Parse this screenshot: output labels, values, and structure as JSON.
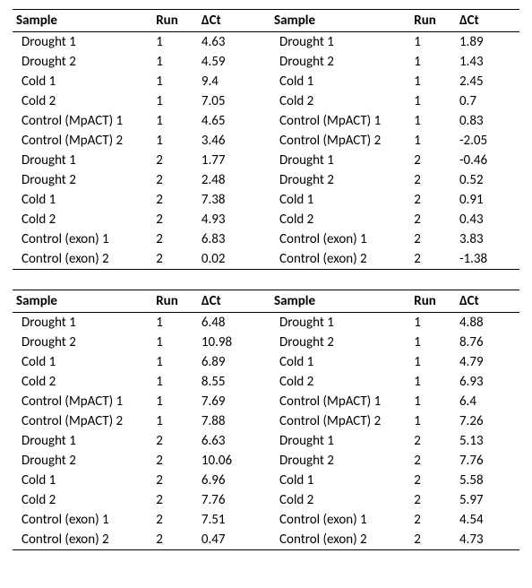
{
  "headers": {
    "sample": "Sample",
    "run": "Run",
    "dct": "ΔCt"
  },
  "sample_names": {
    "drought1": "Drought 1",
    "drought2": "Drought 2",
    "cold1": "Cold 1",
    "cold2": "Cold 2",
    "mpact1": "Control (MpACT) 1",
    "mpact2": "Control (MpACT) 2",
    "exon1": "Control (exon) 1",
    "exon2": "Control (exon) 2"
  },
  "tables": [
    {
      "left": [
        {
          "sample_key": "drought1",
          "run": "1",
          "dct": "4.63"
        },
        {
          "sample_key": "drought2",
          "run": "1",
          "dct": "4.59"
        },
        {
          "sample_key": "cold1",
          "run": "1",
          "dct": "9.4"
        },
        {
          "sample_key": "cold2",
          "run": "1",
          "dct": "7.05"
        },
        {
          "sample_key": "mpact1",
          "run": "1",
          "dct": "4.65"
        },
        {
          "sample_key": "mpact2",
          "run": "1",
          "dct": "3.46"
        },
        {
          "sample_key": "drought1",
          "run": "2",
          "dct": "1.77"
        },
        {
          "sample_key": "drought2",
          "run": "2",
          "dct": "2.48"
        },
        {
          "sample_key": "cold1",
          "run": "2",
          "dct": "7.38"
        },
        {
          "sample_key": "cold2",
          "run": "2",
          "dct": "4.93"
        },
        {
          "sample_key": "exon1",
          "run": "2",
          "dct": "6.83"
        },
        {
          "sample_key": "exon2",
          "run": "2",
          "dct": "0.02"
        }
      ],
      "right": [
        {
          "sample_key": "drought1",
          "run": "1",
          "dct": "1.89"
        },
        {
          "sample_key": "drought2",
          "run": "1",
          "dct": "1.43"
        },
        {
          "sample_key": "cold1",
          "run": "1",
          "dct": "2.45"
        },
        {
          "sample_key": "cold2",
          "run": "1",
          "dct": "0.7"
        },
        {
          "sample_key": "mpact1",
          "run": "1",
          "dct": "0.83"
        },
        {
          "sample_key": "mpact2",
          "run": "1",
          "dct": "-2.05"
        },
        {
          "sample_key": "drought1",
          "run": "2",
          "dct": "-0.46"
        },
        {
          "sample_key": "drought2",
          "run": "2",
          "dct": "0.52"
        },
        {
          "sample_key": "cold1",
          "run": "2",
          "dct": "0.91"
        },
        {
          "sample_key": "cold2",
          "run": "2",
          "dct": "0.43"
        },
        {
          "sample_key": "exon1",
          "run": "2",
          "dct": "3.83"
        },
        {
          "sample_key": "exon2",
          "run": "2",
          "dct": "-1.38"
        }
      ]
    },
    {
      "left": [
        {
          "sample_key": "drought1",
          "run": "1",
          "dct": "6.48"
        },
        {
          "sample_key": "drought2",
          "run": "1",
          "dct": "10.98"
        },
        {
          "sample_key": "cold1",
          "run": "1",
          "dct": "6.89"
        },
        {
          "sample_key": "cold2",
          "run": "1",
          "dct": "8.55"
        },
        {
          "sample_key": "mpact1",
          "run": "1",
          "dct": "7.69"
        },
        {
          "sample_key": "mpact2",
          "run": "1",
          "dct": "7.88"
        },
        {
          "sample_key": "drought1",
          "run": "2",
          "dct": "6.63"
        },
        {
          "sample_key": "drought2",
          "run": "2",
          "dct": "10.06"
        },
        {
          "sample_key": "cold1",
          "run": "2",
          "dct": "6.96"
        },
        {
          "sample_key": "cold2",
          "run": "2",
          "dct": "7.76"
        },
        {
          "sample_key": "exon1",
          "run": "2",
          "dct": "7.51"
        },
        {
          "sample_key": "exon2",
          "run": "2",
          "dct": "0.47"
        }
      ],
      "right": [
        {
          "sample_key": "drought1",
          "run": "1",
          "dct": "4.88"
        },
        {
          "sample_key": "drought2",
          "run": "1",
          "dct": "8.76"
        },
        {
          "sample_key": "cold1",
          "run": "1",
          "dct": "4.79"
        },
        {
          "sample_key": "cold2",
          "run": "1",
          "dct": "6.93"
        },
        {
          "sample_key": "mpact1",
          "run": "1",
          "dct": "6.4"
        },
        {
          "sample_key": "mpact2",
          "run": "1",
          "dct": "7.26"
        },
        {
          "sample_key": "drought1",
          "run": "2",
          "dct": "5.13"
        },
        {
          "sample_key": "drought2",
          "run": "2",
          "dct": "7.76"
        },
        {
          "sample_key": "cold1",
          "run": "2",
          "dct": "5.58"
        },
        {
          "sample_key": "cold2",
          "run": "2",
          "dct": "5.97"
        },
        {
          "sample_key": "exon1",
          "run": "2",
          "dct": "4.54"
        },
        {
          "sample_key": "exon2",
          "run": "2",
          "dct": "4.73"
        }
      ]
    }
  ]
}
